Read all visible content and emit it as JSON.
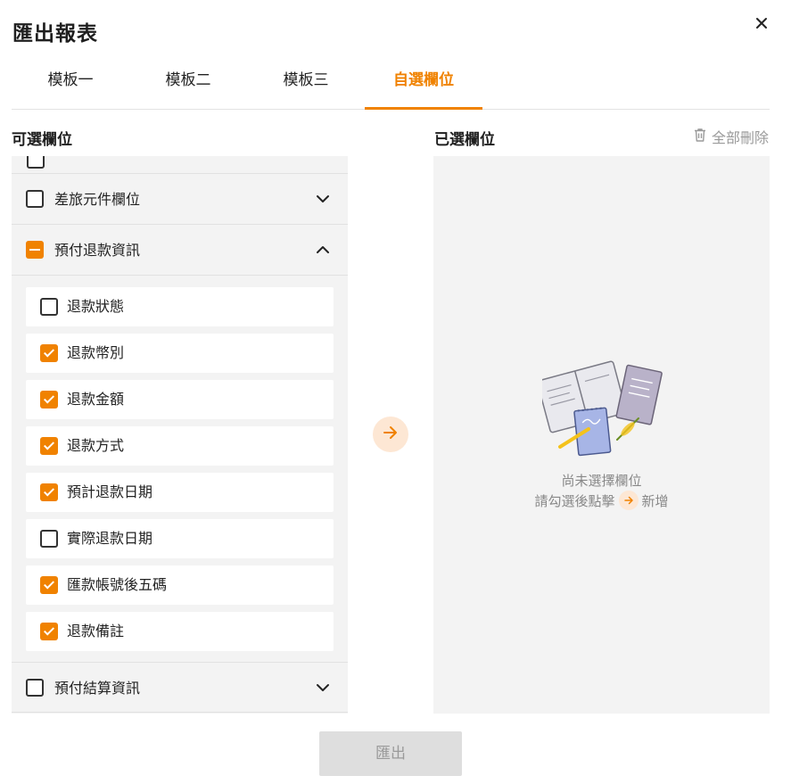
{
  "dialog": {
    "title": "匯出報表"
  },
  "tabs": [
    {
      "label": "模板一",
      "active": false
    },
    {
      "label": "模板二",
      "active": false
    },
    {
      "label": "模板三",
      "active": false
    },
    {
      "label": "自選欄位",
      "active": true
    }
  ],
  "available": {
    "title": "可選欄位",
    "groups": [
      {
        "label": "差旅元件欄位",
        "state": "unchecked",
        "expanded": false
      },
      {
        "label": "預付退款資訊",
        "state": "indeterminate",
        "expanded": true,
        "items": [
          {
            "label": "退款狀態",
            "checked": false
          },
          {
            "label": "退款幣別",
            "checked": true
          },
          {
            "label": "退款金額",
            "checked": true
          },
          {
            "label": "退款方式",
            "checked": true
          },
          {
            "label": "預計退款日期",
            "checked": true
          },
          {
            "label": "實際退款日期",
            "checked": false
          },
          {
            "label": "匯款帳號後五碼",
            "checked": true
          },
          {
            "label": "退款備註",
            "checked": true
          }
        ]
      },
      {
        "label": "預付結算資訊",
        "state": "unchecked",
        "expanded": false
      }
    ]
  },
  "selected": {
    "title": "已選欄位",
    "clear_all": "全部刪除",
    "empty_line1": "尚未選擇欄位",
    "empty_line2_prefix": "請勾選後點擊",
    "empty_line2_suffix": "新增"
  },
  "footer": {
    "export_label": "匯出",
    "export_enabled": false
  },
  "colors": {
    "accent": "#f08200",
    "accent_soft": "#fde7d4",
    "panel_bg": "#f3f3f3",
    "muted_text": "#888888"
  },
  "icons": {
    "close": "close-icon",
    "trash": "trash-icon",
    "arrow": "arrow-right-icon",
    "chevron_down": "chevron-down-icon",
    "chevron_up": "chevron-up-icon"
  }
}
